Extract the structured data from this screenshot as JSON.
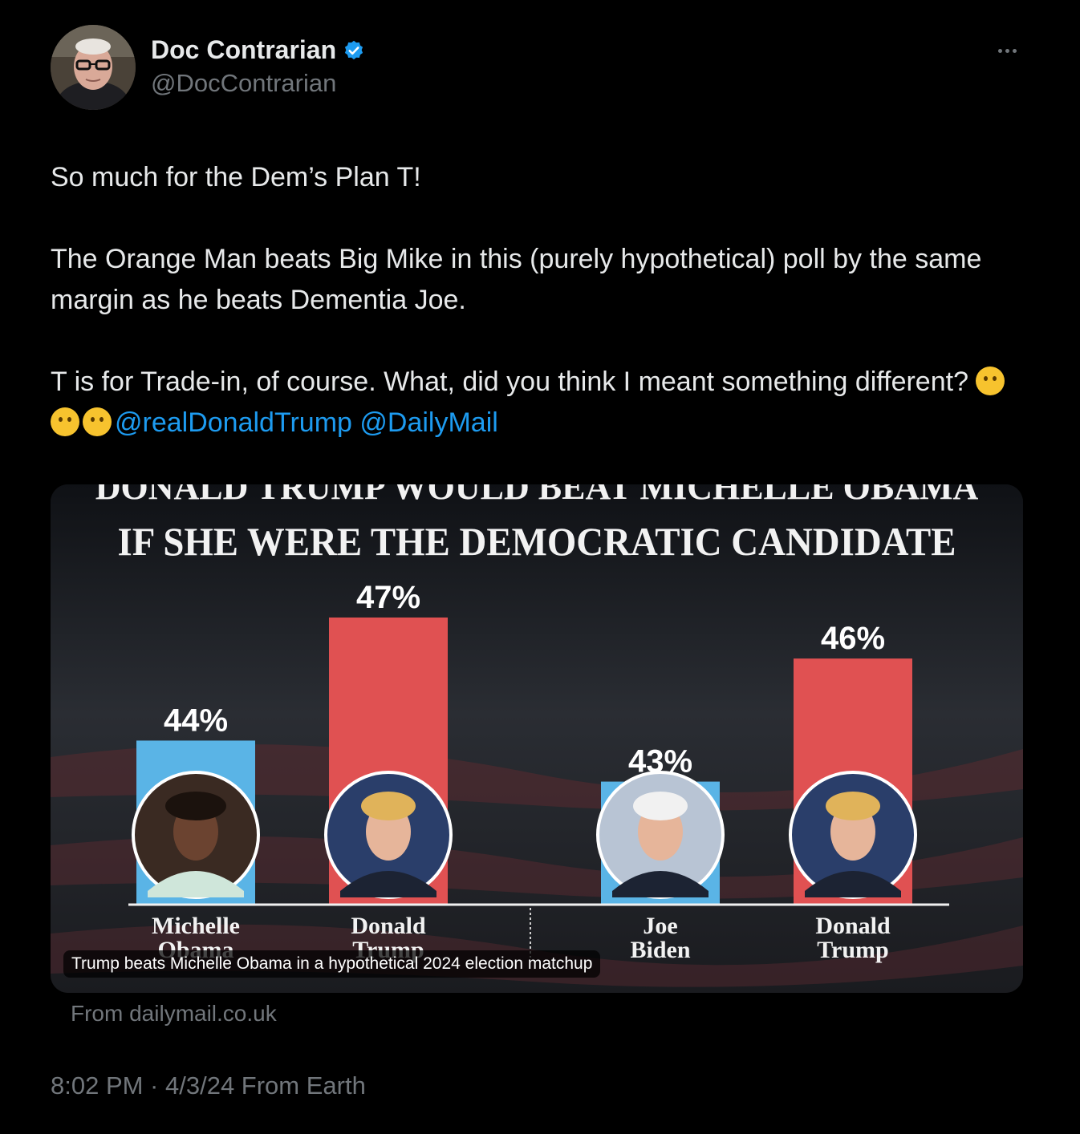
{
  "user": {
    "display_name": "Doc Contrarian",
    "handle": "@DocContrarian",
    "verified": true,
    "verified_color": "#1d9bf0"
  },
  "tweet": {
    "line1": "So much for the Dem’s Plan T!",
    "para2": "The Orange Man beats Big Mike in this (purely hypothetical) poll by the same margin as he beats Dementia Joe.",
    "para3": "T is for Trade-in, of course. What, did you think I meant something different?",
    "emojis": [
      "face-with-hand-over-mouth",
      "winking-face",
      "winking-face"
    ],
    "mention1": "@realDonaldTrump",
    "mention2": "@DailyMail",
    "mention_color": "#1d9bf0"
  },
  "media": {
    "headline_line1": "DONALD TRUMP WOULD BEAT MICHELLE OBAMA",
    "headline_line2": "IF SHE WERE THE DEMOCRATIC CANDIDATE",
    "caption": "Trump beats Michelle Obama in a hypothetical 2024 election matchup",
    "source": "From dailymail.co.uk"
  },
  "chart_data": {
    "type": "bar",
    "title": "DONALD TRUMP WOULD BEAT MICHELLE OBAMA IF SHE WERE THE DEMOCRATIC CANDIDATE",
    "categories": [
      "Michelle Obama",
      "Donald Trump",
      "Joe Biden",
      "Donald Trump"
    ],
    "value_labels": [
      "44%",
      "47%",
      "43%",
      "46%"
    ],
    "values": [
      44,
      47,
      43,
      46
    ],
    "colors": [
      "#5ab4e6",
      "#e05152",
      "#5ab4e6",
      "#e05152"
    ],
    "groups": [
      [
        "Michelle Obama",
        "Donald Trump"
      ],
      [
        "Joe Biden",
        "Donald Trump"
      ]
    ]
  },
  "footer": {
    "timestamp": "8:02 PM · 4/3/24 From Earth"
  }
}
